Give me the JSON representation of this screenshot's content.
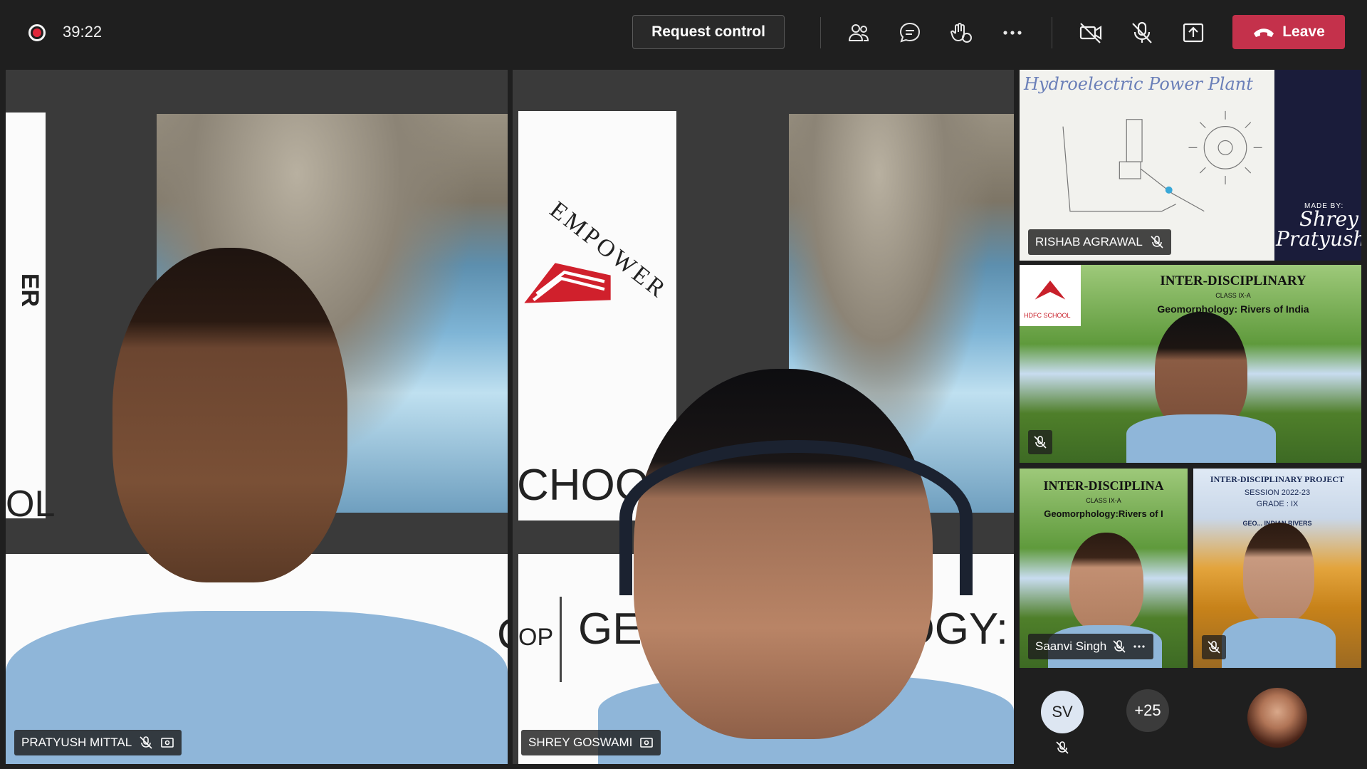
{
  "toolbar": {
    "timer": "39:22",
    "request_control_label": "Request control",
    "leave_label": "Leave",
    "icons": [
      "record-icon",
      "participants-icon",
      "chat-icon",
      "reactions-icon",
      "more-icon",
      "camera-off-icon",
      "mic-off-icon",
      "share-tray-icon",
      "leave-phone-icon"
    ]
  },
  "tiles": {
    "pratyush": {
      "name": "PRATYUSH MITTAL"
    },
    "shrey": {
      "name": "SHREY GOSWAMI"
    },
    "rishab": {
      "name": "RISHAB AGRAWAL",
      "poster_title": "Hydroelectric Power Plant",
      "made_by": "MADE BY:",
      "signature": "Shrey Pratyush"
    },
    "tile2": {
      "title": "INTER-DISCIPLINARY",
      "subtitle": "CLASS IX-A",
      "line": "Geomorphology: Rivers of India",
      "school": "HDFC SCHOOL"
    },
    "saanvi": {
      "name": "Saanvi Singh",
      "title": "INTER-DISCIPLINA",
      "subtitle": "CLASS IX-A",
      "line": "Geomorphology:Rivers of I"
    },
    "tile4": {
      "title": "INTER-DISCIPLINARY PROJECT",
      "session": "SESSION 2022-23",
      "grade": "GRADE : IX",
      "line": "GEO... INDIAN RIVERS"
    }
  },
  "slide_text": {
    "left_fragment_top": "ER",
    "left_fragment_bottom": "OL",
    "empower": "EMPOWER",
    "school_fragment": "CHOO",
    "geo_left": "GEO",
    "geo_right": "LOGY:",
    "op": "OP",
    "c_fragment": "C"
  },
  "overflow": {
    "initials": "SV",
    "more_count": "+25"
  },
  "colors": {
    "accent": "#6264a7",
    "leave": "#c4314b",
    "record": "#e0273a"
  }
}
